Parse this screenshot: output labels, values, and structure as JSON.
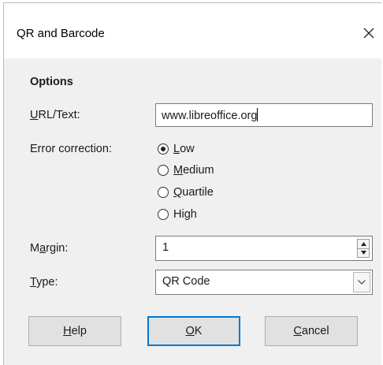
{
  "window": {
    "title": "QR and Barcode"
  },
  "options": {
    "section_title": "Options",
    "url_label": "URL/Text:",
    "url_value": "www.libreoffice.org",
    "error_label": "Error correction:",
    "error_options": [
      "Low",
      "Medium",
      "Quartile",
      "High"
    ],
    "error_selected": "Low",
    "margin_label": "Margin:",
    "margin_value": "1",
    "type_label": "Type:",
    "type_value": "QR Code"
  },
  "buttons": {
    "help": "Help",
    "ok": "OK",
    "cancel": "Cancel"
  },
  "colors": {
    "accent": "#0078d7",
    "dialog_bg": "#f0f0f0"
  }
}
